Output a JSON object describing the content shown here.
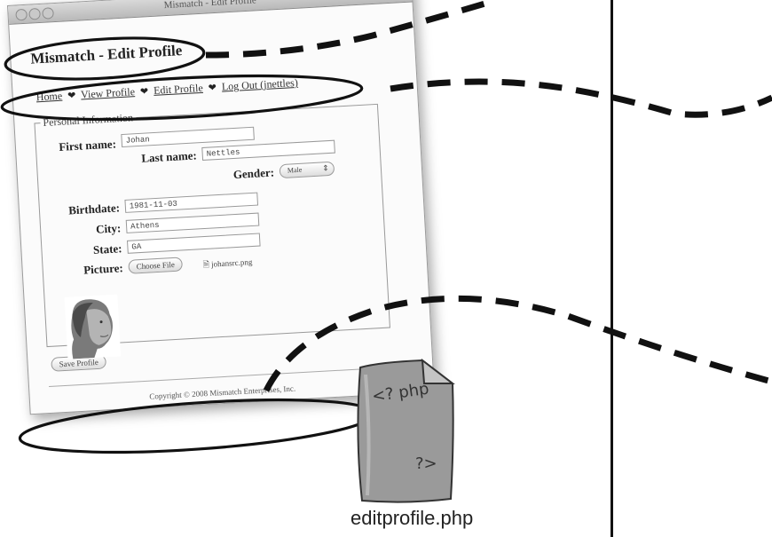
{
  "window": {
    "title": "Mismatch - Edit Profile",
    "page_title": "Mismatch - Edit Profile"
  },
  "nav": {
    "items": [
      "Home",
      "View Profile",
      "Edit Profile",
      "Log Out (jnettles)"
    ],
    "separator_icon": "heart-icon"
  },
  "form": {
    "legend": "Personal Information",
    "first_name_label": "First name:",
    "first_name_value": "Johan",
    "last_name_label": "Last name:",
    "last_name_value": "Nettles",
    "gender_label": "Gender:",
    "gender_value": "Male",
    "birthdate_label": "Birthdate:",
    "birthdate_value": "1981-11-03",
    "city_label": "City:",
    "city_value": "Athens",
    "state_label": "State:",
    "state_value": "GA",
    "picture_label": "Picture:",
    "choose_file_label": "Choose File",
    "file_name": "johansrc.png",
    "save_label": "Save Profile"
  },
  "footer": {
    "copyright": "Copyright © 2008 Mismatch Enterprises, Inc."
  },
  "file_icon": {
    "open_tag": "<? php",
    "close_tag": "?>"
  },
  "caption": "editprofile.php"
}
